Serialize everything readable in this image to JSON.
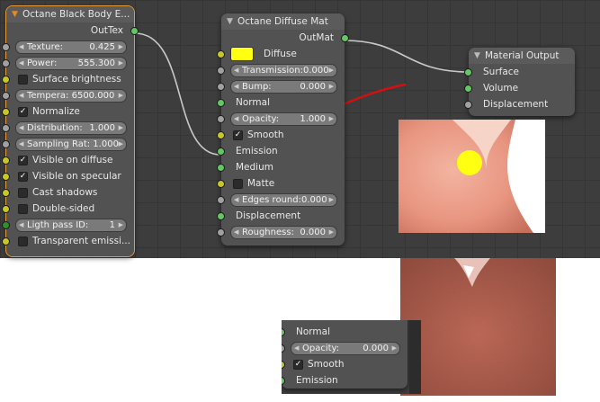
{
  "blackbody": {
    "title": "Octane Black Body E...",
    "output": "OutTex",
    "texture": {
      "label": "Texture:",
      "value": "0.425"
    },
    "power": {
      "label": "Power:",
      "value": "555.300"
    },
    "surface_brightness": "Surface brightness",
    "temperature": {
      "label": "Tempera: 6500.000"
    },
    "normalize": "Normalize",
    "distribution": {
      "label": "Distribution:",
      "value": "1.000"
    },
    "sampling_rate": {
      "label": "Sampling Rat: 1.000"
    },
    "visible_diffuse": "Visible on diffuse",
    "visible_specular": "Visible on specular",
    "cast_shadows": "Cast shadows",
    "double_sided": "Double-sided",
    "light_pass_id": {
      "label": "Ligth pass ID:",
      "value": "1"
    },
    "transparent_emission": "Transparent emissi..."
  },
  "diffuse": {
    "title": "Octane Diffuse Mat",
    "output": "OutMat",
    "diffuse": "Diffuse",
    "diffuse_color": "#ffff11",
    "transmission": {
      "label": "Transmission:0.000"
    },
    "bump": {
      "label": "Bump:",
      "value": "0.000"
    },
    "normal": "Normal",
    "opacity": {
      "label": "Opacity:",
      "value": "1.000"
    },
    "smooth": "Smooth",
    "emission": "Emission",
    "medium": "Medium",
    "matte": "Matte",
    "edges_round": {
      "label": "Edges round:0.000"
    },
    "displacement": "Displacement",
    "roughness": {
      "label": "Roughness:",
      "value": "0.000"
    }
  },
  "material_output": {
    "title": "Material Output",
    "surface": "Surface",
    "volume": "Volume",
    "displacement": "Displacement"
  },
  "crop": {
    "normal": "Normal",
    "opacity": {
      "label": "Opacity:",
      "value": "0.000"
    },
    "smooth": "Smooth",
    "emission": "Emission"
  },
  "colors": {
    "annotation_arrow": "#d21010",
    "selection_outline": "#e69a3a",
    "socket_yellow": "#c7c729",
    "socket_green": "#63c763",
    "socket_grey": "#a1a1a1"
  }
}
